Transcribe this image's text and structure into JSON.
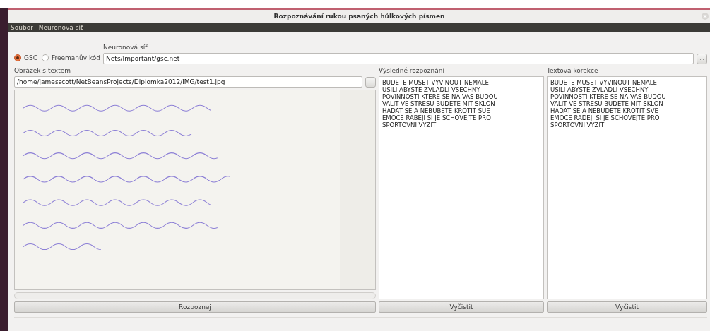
{
  "window": {
    "title": "Rozpoznávání rukou psaných hůlkových písmen"
  },
  "menu": [
    {
      "label": "Soubor"
    },
    {
      "label": "Neuronová síť"
    }
  ],
  "feature_options": [
    {
      "label": "GSC",
      "selected": true
    },
    {
      "label": "Freemanův kód",
      "selected": false
    }
  ],
  "network": {
    "label": "Neuronová síť",
    "value": "Nets/Important/gsc.net",
    "browse": "..."
  },
  "image_panel": {
    "label": "Obrázek s textem",
    "path": "/home/jamesscott/NetBeansProjects/Diplomka2012/IMG/test1.jpg",
    "browse": "...",
    "button": "Rozpoznej"
  },
  "result_panel": {
    "label": "Výsledné rozpoznání",
    "lines": [
      "BUDETE MUSET VYVINOUT NEMALE",
      "USILI ABYSTE ZVLADLI VSECHNY",
      "POVINNOSTI KTERE SE NA VAS BUDOU",
      "VALIT VE STRESU BUDETE MIT SKLON",
      "HADAT SE A NEBUBETE KROTIT SUE",
      "EMOCE RABEJI SI JE SCHOVEJTE PRO",
      "SPORTOVNI VYZITI"
    ],
    "button": "Vyčistit"
  },
  "correction_panel": {
    "label": "Textová korekce",
    "lines": [
      "BUDETE MUSET VYVINOUT NEMALE",
      "USILI ABYSTE ZVLADLI VSECHNY",
      "POVINNOSTI KTERE SE NA VAS BUDOU",
      "VALIT VE STRESU BUDETE MIT SKLON",
      "HADAT SE A NEBUDETE KROTIT SVE",
      "EMOCE RADEJI SI JE SCHOVEJTE PRO",
      "SPORTOVNI VYZITI"
    ],
    "button": "Vyčistit"
  }
}
